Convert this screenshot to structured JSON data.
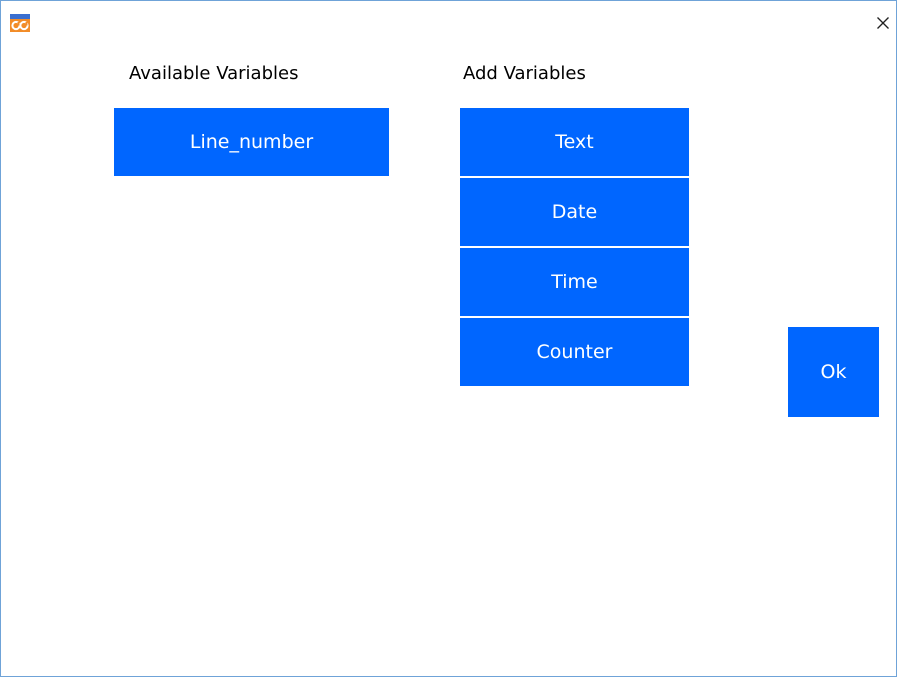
{
  "window": {
    "app_icon": "app-logo-icon",
    "close_icon": "close-icon",
    "close_glyph": "✕"
  },
  "available": {
    "title": "Available Variables",
    "items": [
      {
        "label": "Line_number"
      }
    ]
  },
  "add": {
    "title": "Add Variables",
    "items": [
      {
        "label": "Text"
      },
      {
        "label": "Date"
      },
      {
        "label": "Time"
      },
      {
        "label": "Counter"
      }
    ]
  },
  "actions": {
    "ok_label": "Ok"
  },
  "colors": {
    "accent": "#0066ff",
    "button_text": "#ffffff",
    "window_border": "#6fa3d8"
  }
}
